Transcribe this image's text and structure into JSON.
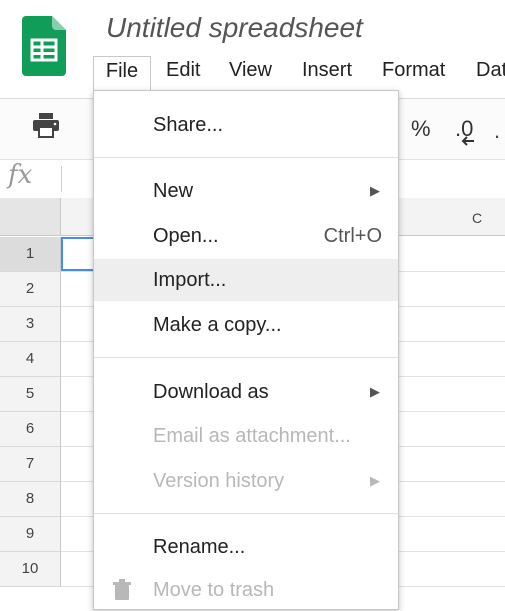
{
  "app": {
    "document_title": "Untitled spreadsheet",
    "logo_icon": "google-sheets-icon",
    "brand_color": "#0f9d58"
  },
  "menubar": {
    "items": [
      {
        "label": "File"
      },
      {
        "label": "Edit"
      },
      {
        "label": "View"
      },
      {
        "label": "Insert"
      },
      {
        "label": "Format"
      },
      {
        "label": "Data"
      }
    ]
  },
  "toolbar": {
    "print_icon": "print-icon",
    "percent": "%",
    "decimal": ".0",
    "more_icon": "text-format-icon"
  },
  "formula_bar": {
    "fx": "fx"
  },
  "grid": {
    "column_headers": [
      "C"
    ],
    "row_headers": [
      "1",
      "2",
      "3",
      "4",
      "5",
      "6",
      "7",
      "8",
      "9",
      "10"
    ],
    "active_row": "1",
    "selection_color": "#4a89f3"
  },
  "file_menu": {
    "items": [
      {
        "label": "Share...",
        "shortcut": "",
        "submenu": false,
        "disabled": false
      },
      {
        "label": "New",
        "shortcut": "",
        "submenu": true,
        "disabled": false
      },
      {
        "label": "Open...",
        "shortcut": "Ctrl+O",
        "submenu": false,
        "disabled": false
      },
      {
        "label": "Import...",
        "shortcut": "",
        "submenu": false,
        "disabled": false,
        "highlighted": true
      },
      {
        "label": "Make a copy...",
        "shortcut": "",
        "submenu": false,
        "disabled": false
      },
      {
        "label": "Download as",
        "shortcut": "",
        "submenu": true,
        "disabled": false
      },
      {
        "label": "Email as attachment...",
        "shortcut": "",
        "submenu": false,
        "disabled": true
      },
      {
        "label": "Version history",
        "shortcut": "",
        "submenu": true,
        "disabled": true
      },
      {
        "label": "Rename...",
        "shortcut": "",
        "submenu": false,
        "disabled": false
      },
      {
        "label": "Move to trash",
        "shortcut": "",
        "submenu": false,
        "disabled": false,
        "icon": "trash-icon"
      }
    ]
  }
}
